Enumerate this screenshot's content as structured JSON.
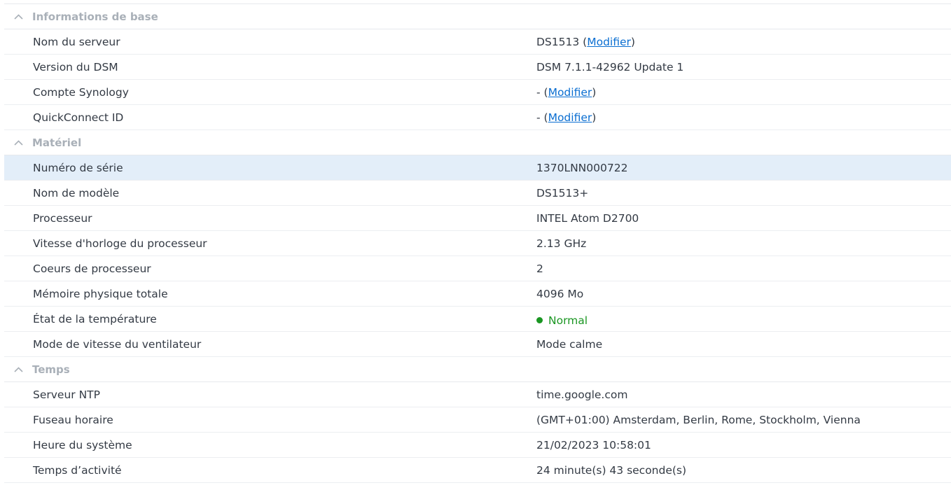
{
  "colors": {
    "section_title": "#a9b0b8",
    "link": "#0a6ed1",
    "status_normal": "#1a9622",
    "selected_row": "#e3eef9"
  },
  "sections": {
    "basic": {
      "title": "Informations de base",
      "server_name": {
        "label": "Nom du serveur",
        "value": "DS1513",
        "link": "Modifier"
      },
      "dsm_version": {
        "label": "Version du DSM",
        "value": "DSM 7.1.1-42962 Update 1"
      },
      "synology_account": {
        "label": "Compte Synology",
        "value": "-",
        "link": "Modifier"
      },
      "quickconnect": {
        "label": "QuickConnect ID",
        "value": "-",
        "link": "Modifier"
      }
    },
    "hardware": {
      "title": "Matériel",
      "serial": {
        "label": "Numéro de série",
        "value": "1370LNN000722"
      },
      "model": {
        "label": "Nom de modèle",
        "value": "DS1513+"
      },
      "cpu": {
        "label": "Processeur",
        "value": "INTEL Atom D2700"
      },
      "cpu_clock": {
        "label": "Vitesse d'horloge du processeur",
        "value": "2.13 GHz"
      },
      "cpu_cores": {
        "label": "Coeurs de processeur",
        "value": "2"
      },
      "memory": {
        "label": "Mémoire physique totale",
        "value": "4096 Mo"
      },
      "temperature": {
        "label": "État de la température",
        "value": "Normal",
        "icon": "status-dot-icon"
      },
      "fan_mode": {
        "label": "Mode de vitesse du ventilateur",
        "value": "Mode calme"
      }
    },
    "time": {
      "title": "Temps",
      "ntp": {
        "label": "Serveur NTP",
        "value": "time.google.com"
      },
      "timezone": {
        "label": "Fuseau horaire",
        "value": "(GMT+01:00) Amsterdam, Berlin, Rome, Stockholm, Vienna"
      },
      "system_time": {
        "label": "Heure du système",
        "value": "21/02/2023 10:58:01"
      },
      "uptime": {
        "label": "Temps d’activité",
        "value": "24 minute(s) 43 seconde(s)"
      }
    }
  },
  "icons": {
    "section_toggle": "chevron-up-icon"
  }
}
